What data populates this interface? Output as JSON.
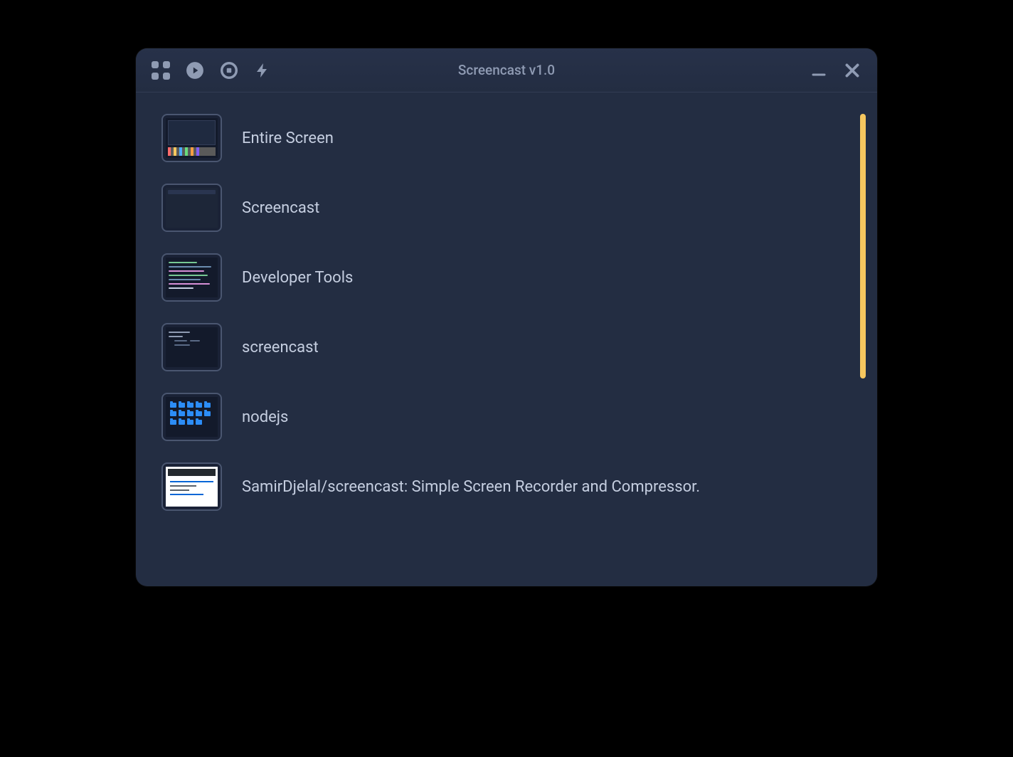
{
  "window": {
    "title": "Screencast v1.0"
  },
  "toolbar": {
    "grid": "grid-icon",
    "play": "play-icon",
    "stop": "stop-icon",
    "flash": "flash-icon",
    "minimize": "minimize-icon",
    "close": "close-icon"
  },
  "sources": [
    {
      "label": "Entire Screen",
      "preview": "entire"
    },
    {
      "label": "Screencast",
      "preview": "blank"
    },
    {
      "label": "Developer Tools",
      "preview": "code"
    },
    {
      "label": "screencast",
      "preview": "terminal"
    },
    {
      "label": "nodejs",
      "preview": "folders"
    },
    {
      "label": "SamirDjelal/screencast: Simple Screen Recorder and Compressor.",
      "preview": "github"
    }
  ],
  "colors": {
    "bg": "#232d42",
    "text_muted": "#8f9bb3",
    "text": "#c5cee0",
    "accent": "#f6c75f"
  }
}
